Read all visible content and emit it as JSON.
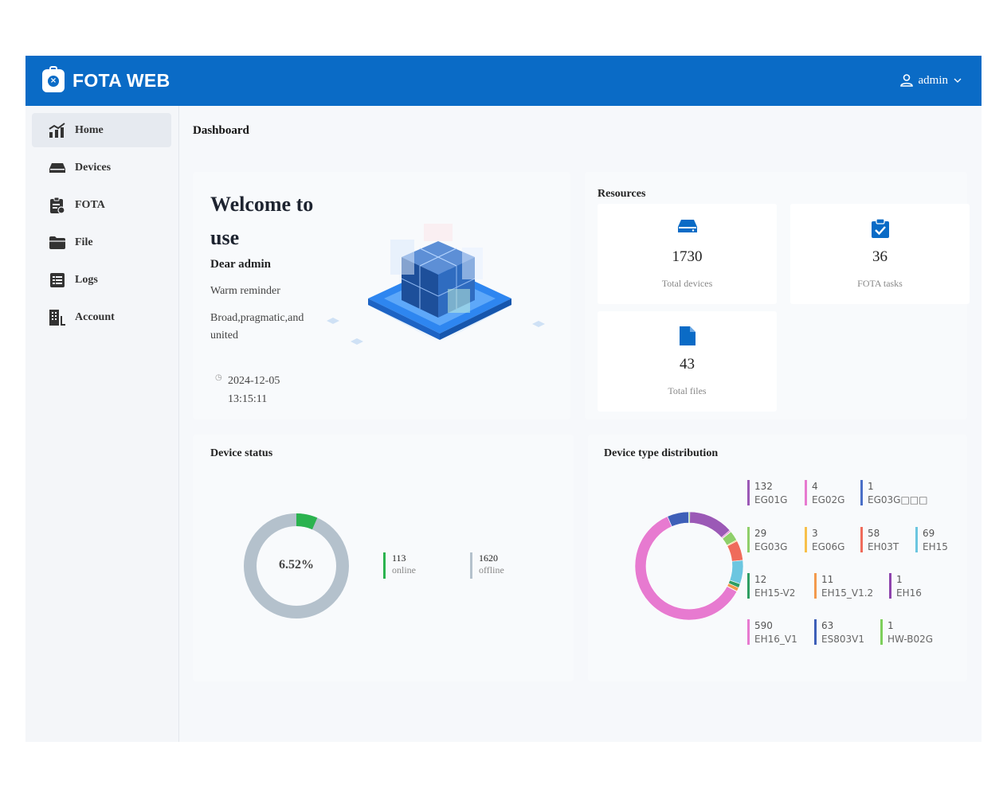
{
  "app": {
    "title": "FOTA WEB",
    "user": "admin"
  },
  "sidebar": {
    "items": [
      {
        "label": "Home",
        "icon": "chart-icon",
        "active": true
      },
      {
        "label": "Devices",
        "icon": "drive-icon"
      },
      {
        "label": "FOTA",
        "icon": "clipboard-icon"
      },
      {
        "label": "File",
        "icon": "folder-icon"
      },
      {
        "label": "Logs",
        "icon": "list-icon"
      },
      {
        "label": "Account",
        "icon": "building-icon"
      }
    ]
  },
  "breadcrumb": "Dashboard",
  "welcome": {
    "title": "Welcome to use",
    "greeting": "Dear admin",
    "reminder": "Warm reminder",
    "motto": "Broad,pragmatic,and united",
    "date": "2024-12-05",
    "time": "13:15:11"
  },
  "resources": {
    "title": "Resources",
    "items": [
      {
        "value": "1730",
        "label": "Total devices",
        "icon": "drive-icon"
      },
      {
        "value": "36",
        "label": "FOTA tasks",
        "icon": "task-check-icon"
      },
      {
        "value": "43",
        "label": "Total files",
        "icon": "file-icon"
      }
    ]
  },
  "device_status": {
    "title": "Device status",
    "percent": "6.52%",
    "online": {
      "value": "113",
      "label": "online",
      "color": "#2bb34f"
    },
    "offline": {
      "value": "1620",
      "label": "offline",
      "color": "#b4c1cc"
    }
  },
  "device_types": {
    "title": "Device type distribution",
    "items": [
      {
        "name": "EG01G",
        "value": 132,
        "color": "#9b59b6"
      },
      {
        "name": "EG02G",
        "value": 4,
        "color": "#e77ad0"
      },
      {
        "name": "EG03G□□□",
        "value": 1,
        "color": "#4a6fc7"
      },
      {
        "name": "EG03G",
        "value": 29,
        "color": "#8fcf6a"
      },
      {
        "name": "EG06G",
        "value": 3,
        "color": "#f7c04a"
      },
      {
        "name": "EH03T",
        "value": 58,
        "color": "#ef6b5b"
      },
      {
        "name": "EH15",
        "value": 69,
        "color": "#6cc6e0"
      },
      {
        "name": "EH15-V2",
        "value": 12,
        "color": "#2f9e63"
      },
      {
        "name": "EH15_V1.2",
        "value": 11,
        "color": "#f39a4d"
      },
      {
        "name": "EH16",
        "value": 1,
        "color": "#8e44ad"
      },
      {
        "name": "EH16_V1",
        "value": 590,
        "color": "#e77ad0"
      },
      {
        "name": "ES803V1",
        "value": 63,
        "color": "#3e5fb8"
      },
      {
        "name": "HW-B02G",
        "value": 1,
        "color": "#7dcf5b"
      }
    ]
  },
  "colors": {
    "brand": "#0a6bc6",
    "accent_icon": "#0a6bc6"
  }
}
